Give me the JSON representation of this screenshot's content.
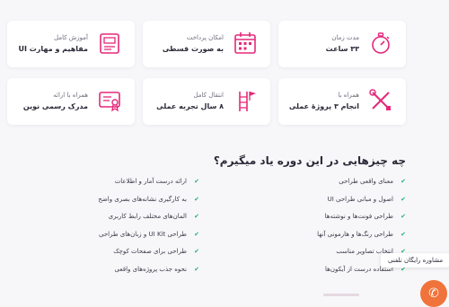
{
  "accent": "#e5297a",
  "check_color": "#22b573",
  "features": [
    {
      "title": "مدت زمان",
      "value": "۳۳ ساعت",
      "icon": "stopwatch-icon"
    },
    {
      "title": "امکان پرداخت",
      "value": "به صورت قسطی",
      "icon": "calendar-icon"
    },
    {
      "title": "آموزش کامل",
      "value": "مفاهیم و مهارت UI",
      "icon": "design-book-icon"
    },
    {
      "title": "همراه با",
      "value": "انجام ۳ پروژۀ عملی",
      "icon": "tools-icon"
    },
    {
      "title": "انتقال کامل",
      "value": "۸ سال تجربه عملی",
      "icon": "flag-ladder-icon"
    },
    {
      "title": "همراه با ارائه",
      "value": "مدرک رسمی نوین",
      "icon": "certificate-icon"
    }
  ],
  "learn": {
    "heading": "چه چیزهایی در این دوره یاد میگیرم؟",
    "right_items": [
      "معنای واقعی طراحی",
      "اصول و مبانی طراحی UI",
      "طراحی فونت‌ها و نوشته‌ها",
      "طراحی رنگ‌ها و هارمونی آنها",
      "انتخاب تصاویر مناسب",
      "استفاده درست از آیکون‌ها"
    ],
    "left_items": [
      "ارائه درست آمار و اطلاعات",
      "به کارگیری نشانه‌های بصری واضح",
      "المان‌های مختلف رابط کاربری",
      "طراحی UI Kit و زبان‌های طراحی",
      "طراحی برای صفحات کوچک",
      "نحوه جذب پروژه‌های واقعی"
    ]
  },
  "support": {
    "tooltip": "مشاوره رایگان تلفنی",
    "icon": "phone-icon"
  }
}
